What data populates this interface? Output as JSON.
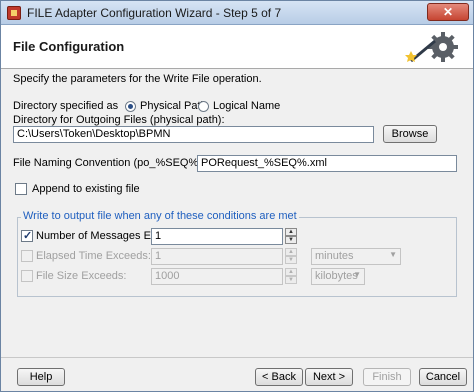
{
  "window": {
    "title": "FILE Adapter Configuration Wizard - Step 5 of 7",
    "close_label": "✕"
  },
  "header": {
    "title": "File Configuration",
    "icon": "gear-with-wand-icon"
  },
  "form": {
    "description": "Specify the parameters for the Write File operation.",
    "directory_label": "Directory specified as",
    "physical_path_label": "Physical Path",
    "logical_name_label": "Logical Name",
    "outgoing_dir_label": "Directory for Outgoing Files (physical path):",
    "outgoing_dir_value": "C:\\Users\\Token\\Desktop\\BPMN",
    "browse_label": "Browse",
    "naming_label": "File Naming Convention (po_%SEQ%.txt):",
    "naming_value": "PORequest_%SEQ%.xml",
    "append_label": "Append to existing file",
    "append_checked": false
  },
  "conditions": {
    "legend": "Write to output file when any of these conditions are met",
    "messages_label": "Number of Messages Equals:",
    "messages_value": "1",
    "messages_checked": true,
    "elapsed_label": "Elapsed Time Exceeds:",
    "elapsed_value": "1",
    "elapsed_unit": "minutes",
    "filesize_label": "File Size Exceeds:",
    "filesize_value": "1000",
    "filesize_unit": "kilobytes"
  },
  "footer": {
    "help": "Help",
    "back": "< Back",
    "next": "Next >",
    "finish": "Finish",
    "cancel": "Cancel"
  }
}
